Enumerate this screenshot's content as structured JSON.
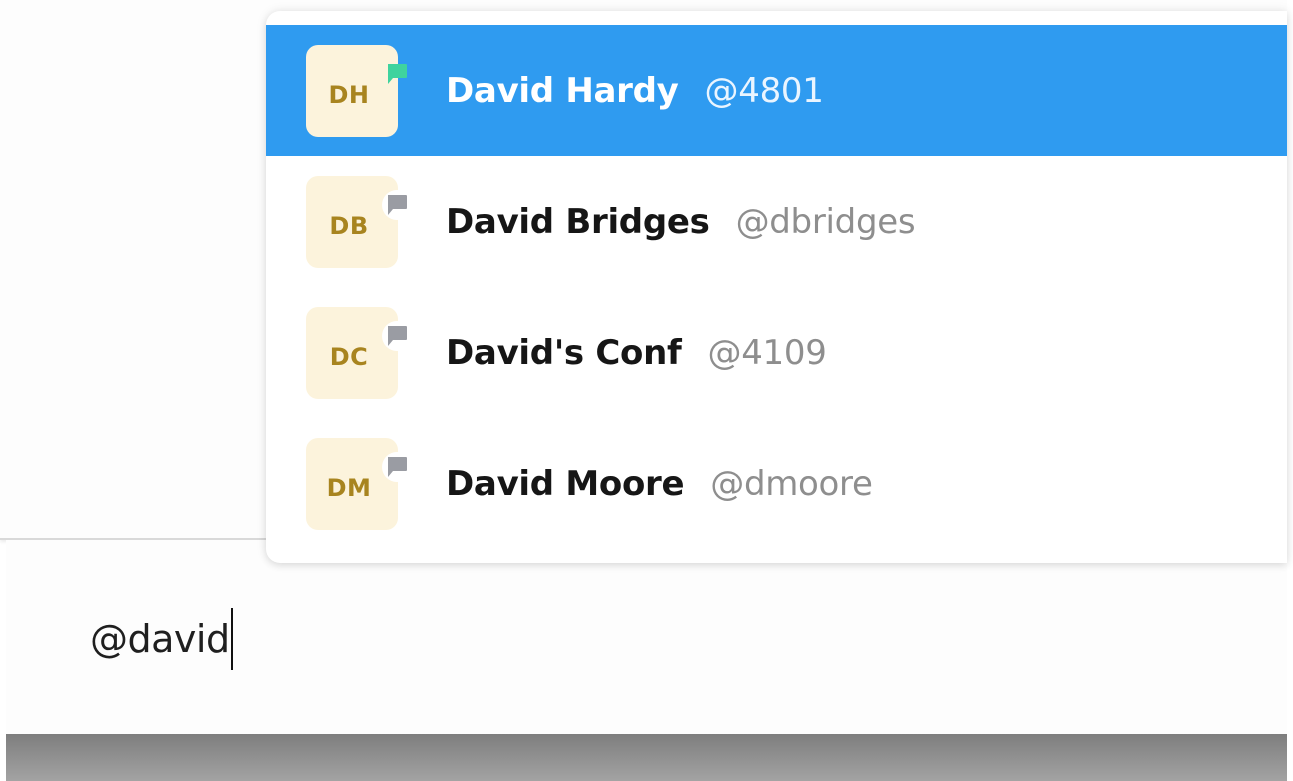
{
  "composer": {
    "value": "@david"
  },
  "mention_popup": {
    "items": [
      {
        "initials": "DH",
        "name": "David Hardy",
        "handle": "@4801",
        "status_icon": "chat-bubble-icon",
        "status_color": "#3fd39e",
        "selected": true
      },
      {
        "initials": "DB",
        "name": "David Bridges",
        "handle": "@dbridges",
        "status_icon": "chat-bubble-icon",
        "status_color": "#9a9ca3",
        "selected": false
      },
      {
        "initials": "DC",
        "name": "David's Conf",
        "handle": "@4109",
        "status_icon": "chat-bubble-icon",
        "status_color": "#9a9ca3",
        "selected": false
      },
      {
        "initials": "DM",
        "name": "David Moore",
        "handle": "@dmoore",
        "status_icon": "chat-bubble-icon",
        "status_color": "#9a9ca3",
        "selected": false
      }
    ]
  },
  "colors": {
    "selection_accent": "#2f9bf0",
    "avatar_background": "#fcf3dc",
    "avatar_text": "#a8841f",
    "online_status": "#3fd39e",
    "offline_status": "#9a9ca3"
  }
}
